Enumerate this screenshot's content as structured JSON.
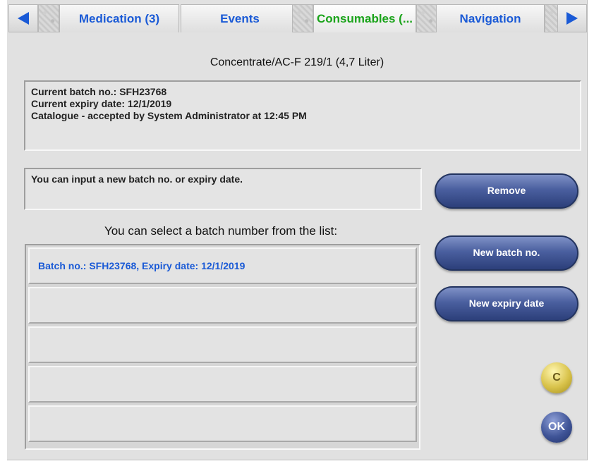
{
  "tabs": [
    {
      "label": "Medication (3)",
      "active": false
    },
    {
      "label": "Events",
      "active": false
    },
    {
      "label": "Consumables (...",
      "active": true
    },
    {
      "label": "Navigation",
      "active": false
    }
  ],
  "colors": {
    "tab_text": "#1a5ad6",
    "tab_active_text": "#1aa31a",
    "arrow": "#1a5ad6",
    "list_text": "#1a5ad6",
    "button": "#4a5f9f"
  },
  "header": {
    "title": "Concentrate/AC-F 219/1 (4,7 Liter)"
  },
  "current_info": {
    "batch_line": "Current batch no.: SFH23768",
    "expiry_line": "Current expiry date: 12/1/2019",
    "catalogue_line": "Catalogue - accepted by System Administrator at 12:45 PM"
  },
  "input_hint": "You can input a new batch no. or expiry date.",
  "list_title": "You can select a batch number from the list:",
  "batch_list": [
    "Batch no.: SFH23768, Expiry date: 12/1/2019",
    "",
    "",
    "",
    ""
  ],
  "buttons": {
    "remove": "Remove",
    "new_batch": "New batch no.",
    "new_expiry": "New expiry date",
    "cancel": "C",
    "ok": "OK"
  }
}
